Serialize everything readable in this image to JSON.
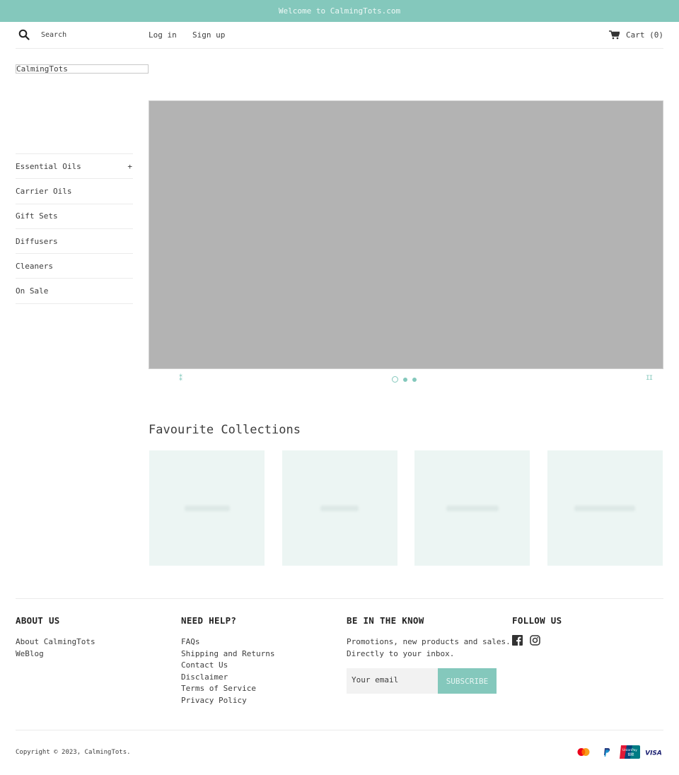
{
  "announcement": "Welcome to CalmingTots.com",
  "header": {
    "search_placeholder": "Search",
    "login": "Log in",
    "signup": "Sign up",
    "cart_label": "Cart (0)",
    "cart_count": 0
  },
  "logo": "CalmingTots",
  "sidebar": {
    "items": [
      {
        "label": "Essential Oils",
        "expand": "+"
      },
      {
        "label": "Carrier Oils"
      },
      {
        "label": "Gift Sets"
      },
      {
        "label": "Diffusers"
      },
      {
        "label": "Cleaners"
      },
      {
        "label": "On Sale"
      }
    ]
  },
  "slideshow": {
    "prev_label": "⁑",
    "pause_label": "II",
    "slides": 3,
    "active_slide": 1
  },
  "collections": {
    "title": "Favourite Collections",
    "items": 4
  },
  "footer": {
    "about": {
      "heading": "ABOUT US",
      "links": [
        "About CalmingTots",
        "WeBlog"
      ]
    },
    "help": {
      "heading": "NEED HELP?",
      "links": [
        "FAQs",
        "Shipping and Returns",
        "Contact Us",
        "Disclaimer",
        "Terms of Service",
        "Privacy Policy"
      ]
    },
    "newsletter": {
      "heading": "BE IN THE KNOW",
      "text_line1": "Promotions, new products and sales.",
      "text_line2": "Directly to your inbox.",
      "email_placeholder": "Your email",
      "subscribe": "SUBSCRIBE"
    },
    "follow": {
      "heading": "FOLLOW US",
      "icons": [
        "facebook-icon",
        "instagram-icon"
      ]
    },
    "copyright": "Copyright © 2023, CalmingTots.",
    "payments": [
      "mastercard",
      "paypal",
      "unionpay",
      "visa"
    ]
  },
  "colors": {
    "accent": "#84c8bc",
    "slide_bg": "#b3b3b3",
    "collection_bg": "#ecf5f3"
  }
}
